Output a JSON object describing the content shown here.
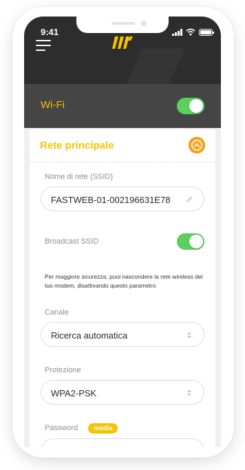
{
  "status_bar": {
    "time": "9:41"
  },
  "app_bar": {
    "menu_icon": "hamburger-icon",
    "logo_icon": "fastweb-logo"
  },
  "wifi": {
    "label": "Wi-Fi",
    "enabled": true
  },
  "section": {
    "title": "Rete principale",
    "collapse_icon": "chevron-up-circle-icon",
    "ssid": {
      "label": "Nome di rete (SSID)",
      "value": "FASTWEB-01-002196631E78",
      "icon": "pencil-icon"
    },
    "broadcast": {
      "label": "Broadcast SSID",
      "enabled": true,
      "help": "Per maggiore sicurezza, puoi nascondere la rete wireless del tuo modem, disattivando questo parametro"
    },
    "channel": {
      "label": "Canale",
      "value": "Ricerca automatica",
      "icon": "select-arrows-icon"
    },
    "protection": {
      "label": "Protezione",
      "value": "WPA2-PSK",
      "icon": "select-arrows-icon"
    },
    "password": {
      "label": "Password",
      "strength_badge": "media",
      "value": "●●●●●●●●●●●●",
      "icon": "eye-icon"
    }
  },
  "colors": {
    "accent": "#f5c400",
    "toggle_on": "#59d15e",
    "header_bg": "#2d2d2d",
    "wifi_bar_bg": "#454545",
    "collapse_btn": "#f5a623"
  }
}
